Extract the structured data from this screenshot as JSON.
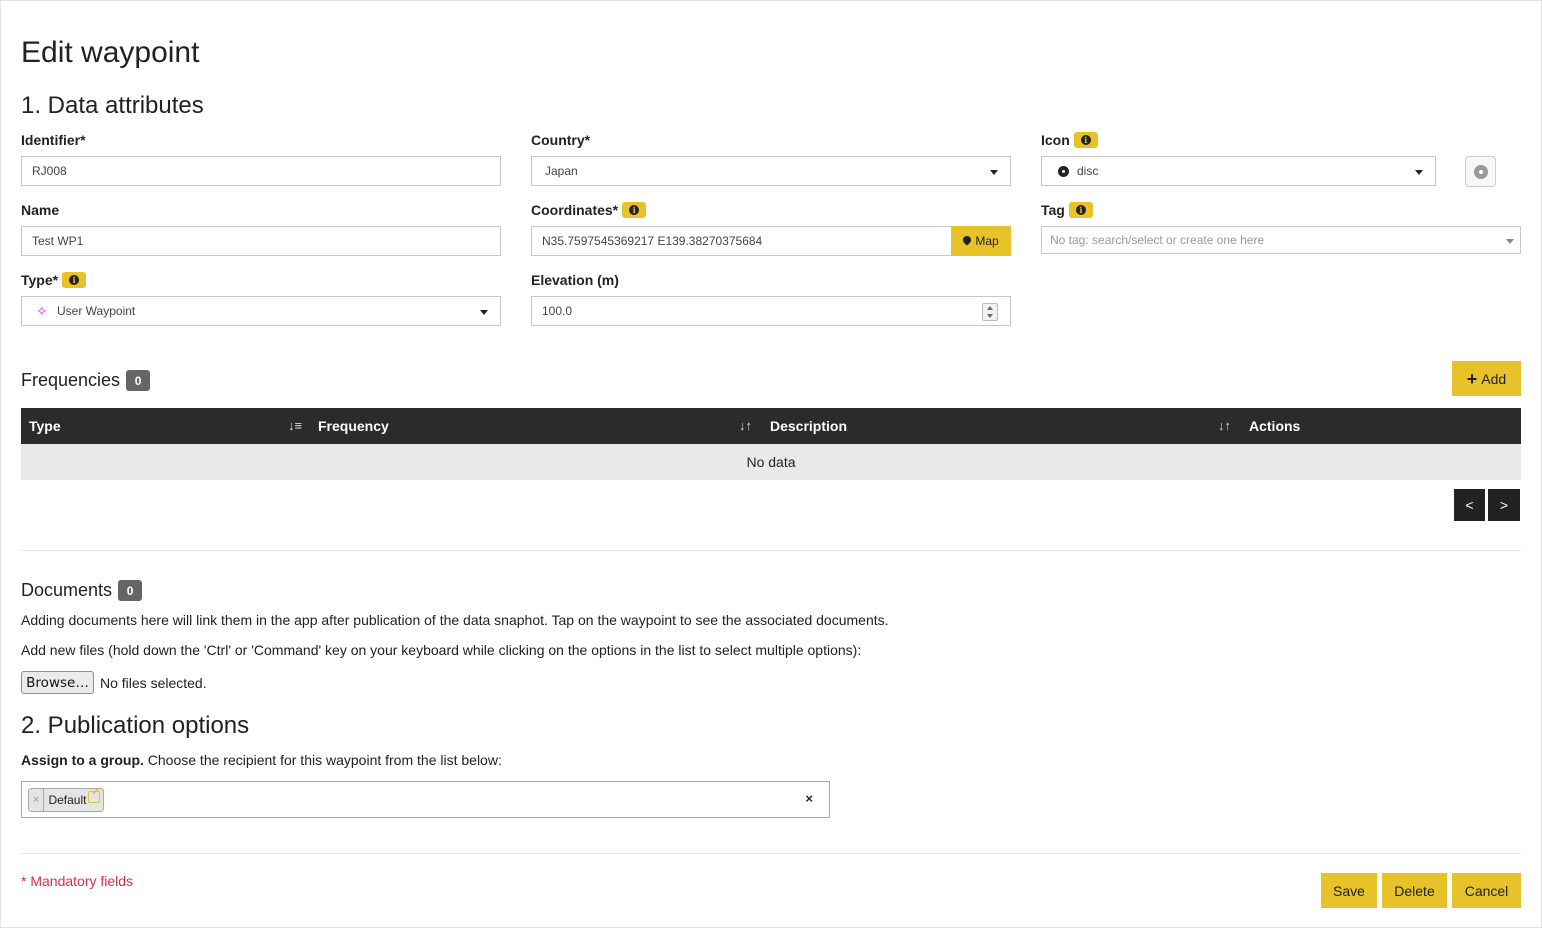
{
  "page": {
    "title": "Edit waypoint"
  },
  "section1": {
    "title": "1. Data attributes"
  },
  "fields": {
    "identifier": {
      "label": "Identifier*",
      "value": "RJ008"
    },
    "country": {
      "label": "Country*",
      "value": "Japan"
    },
    "icon": {
      "label": "Icon",
      "value": "disc",
      "icon_name": "disc-icon"
    },
    "name": {
      "label": "Name",
      "value": "Test WP1"
    },
    "coordinates": {
      "label": "Coordinates*",
      "value": "N35.7597545369217 E139.38270375684",
      "map_button": "Map"
    },
    "tag": {
      "label": "Tag",
      "placeholder": "No tag: search/select or create one here"
    },
    "type": {
      "label": "Type*",
      "value": "User Waypoint",
      "icon_name": "user-waypoint-icon"
    },
    "elevation": {
      "label": "Elevation (m)",
      "value": "100.0"
    }
  },
  "frequencies": {
    "title": "Frequencies",
    "count": "0",
    "add_button": "Add",
    "columns": [
      "Type",
      "Frequency",
      "Description",
      "Actions"
    ],
    "empty_text": "No data",
    "pager": {
      "prev": "<",
      "next": ">"
    }
  },
  "documents": {
    "title": "Documents",
    "count": "0",
    "description": "Adding documents here will link them in the app after publication of the data snaphot. Tap on the waypoint to see the associated documents.",
    "add_files_text": "Add new files (hold down the 'Ctrl' or 'Command' key on your keyboard while clicking on the options in the list to select multiple options):",
    "browse_button": "Browse…",
    "file_status": "No files selected."
  },
  "section2": {
    "title": "2. Publication options",
    "assign_bold": "Assign to a group.",
    "assign_text": "Choose the recipient for this waypoint from the list below:",
    "selected_group": "Default",
    "remove_symbol": "×",
    "clear_symbol": "×"
  },
  "footer": {
    "mandatory_note": "* Mandatory fields",
    "save": "Save",
    "delete": "Delete",
    "cancel": "Cancel"
  },
  "colors": {
    "accent": "#e8c229",
    "table_header": "#2b2b2b",
    "mandatory": "#d9304a"
  }
}
